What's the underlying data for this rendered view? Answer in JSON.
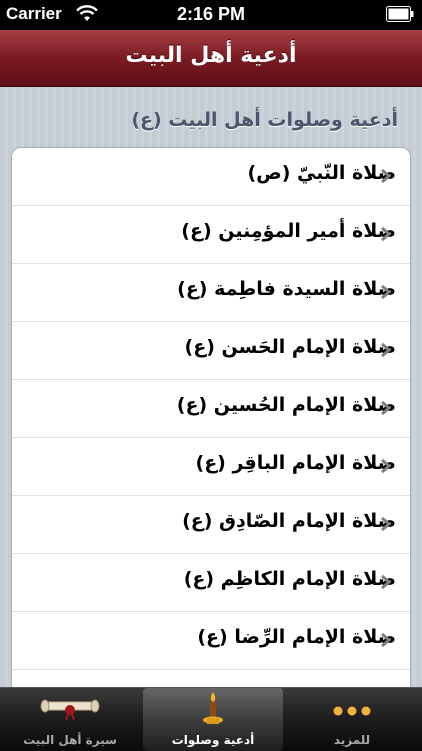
{
  "status_bar": {
    "carrier": "Carrier",
    "time": "2:16 PM"
  },
  "nav": {
    "title": "أدعية أهل البيت"
  },
  "section": {
    "header": "أدعية وصلوات أهل البيت (ع)"
  },
  "rows": [
    {
      "label": "صلاة النّبيّ (ص)"
    },
    {
      "label": "صلاة أمير المؤمِنين (ع)"
    },
    {
      "label": "صلاة السيدة فاطِمة (ع)"
    },
    {
      "label": "صلاة الإمام الحَسن (ع)"
    },
    {
      "label": "صلاة الإمام الحُسين (ع)"
    },
    {
      "label": "صلاة الإمام الباقِر (ع)"
    },
    {
      "label": "صلاة الإمام الصّادِق (ع)"
    },
    {
      "label": "صلاة الإمام الكاظِم (ع)"
    },
    {
      "label": "صلاة الإمام الرِّضا (ع)"
    }
  ],
  "tabs": [
    {
      "label": "سيرة أهل البيت",
      "icon": "scroll-icon",
      "selected": false
    },
    {
      "label": "أدعية وصلوات",
      "icon": "candle-icon",
      "selected": true
    },
    {
      "label": "للمزيد",
      "icon": "more-dots-icon",
      "selected": false
    }
  ],
  "colors": {
    "nav_bar": "#7b1b22",
    "section_header_text": "#4c566c",
    "chevron": "#7f7f7f"
  }
}
